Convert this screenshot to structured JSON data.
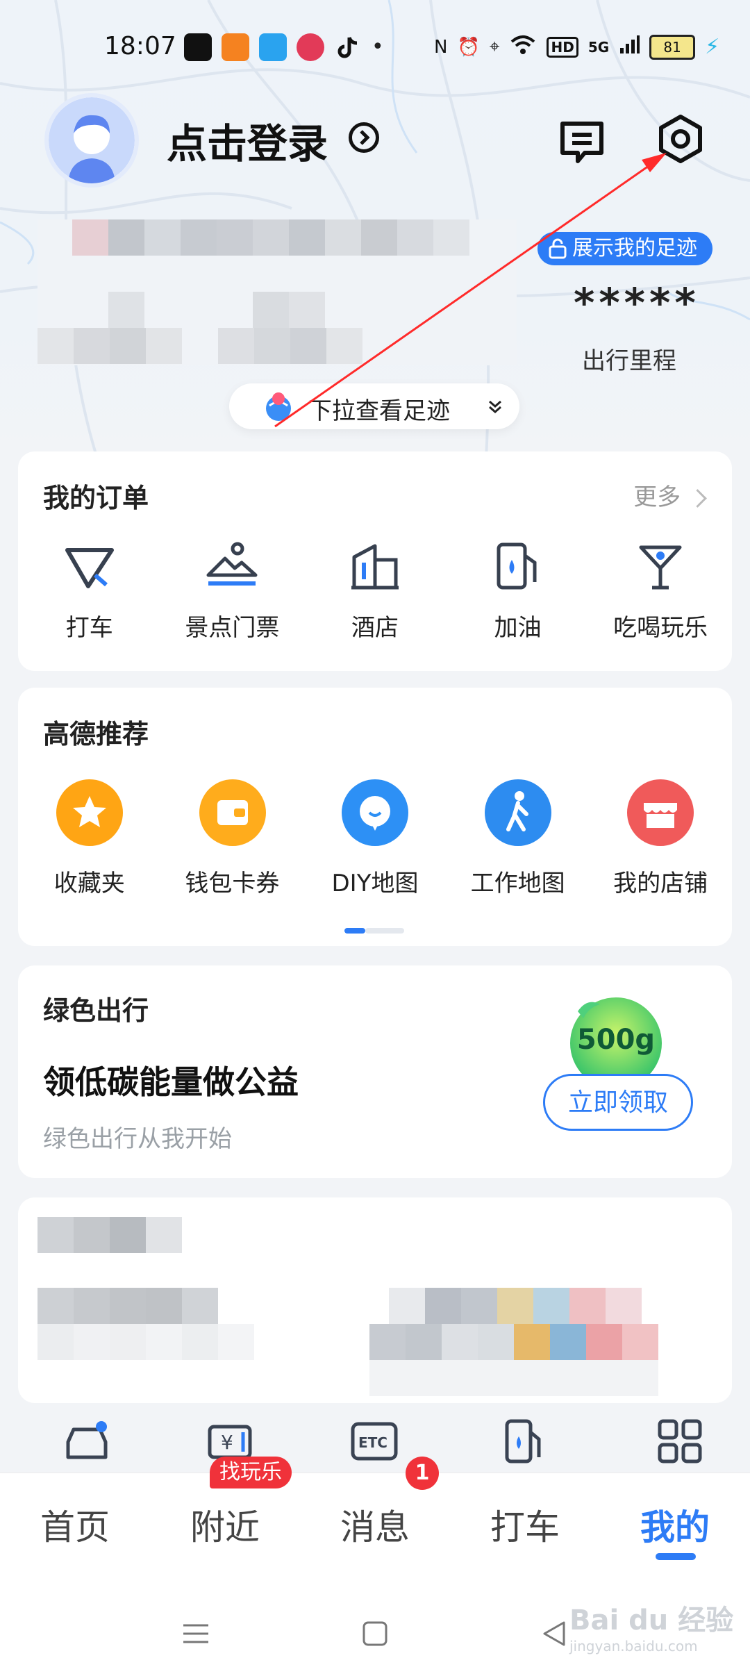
{
  "status_bar": {
    "time": "18:07",
    "network": "5G",
    "hd": "HD",
    "battery": "81"
  },
  "header": {
    "login_text": "点击登录",
    "footprint_badge": "展示我的足迹",
    "mileage_masked": "*****",
    "mileage_label": "出行里程",
    "pull_hint": "下拉查看足迹"
  },
  "orders": {
    "title": "我的订单",
    "more": "更多",
    "items": [
      {
        "label": "打车",
        "icon": "taxi-triangle-icon"
      },
      {
        "label": "景点门票",
        "icon": "scenic-ticket-icon"
      },
      {
        "label": "酒店",
        "icon": "hotel-building-icon"
      },
      {
        "label": "加油",
        "icon": "fuel-pump-icon"
      },
      {
        "label": "吃喝玩乐",
        "icon": "cocktail-icon"
      }
    ]
  },
  "recommend": {
    "title": "高德推荐",
    "items": [
      {
        "label": "收藏夹",
        "icon": "star-icon",
        "color": "#ff9d0a"
      },
      {
        "label": "钱包卡券",
        "icon": "wallet-icon",
        "color": "#ffa514"
      },
      {
        "label": "DIY地图",
        "icon": "diy-map-icon",
        "color": "#2d90f5"
      },
      {
        "label": "工作地图",
        "icon": "walking-person-icon",
        "color": "#2d8cf0"
      },
      {
        "label": "我的店铺",
        "icon": "shop-icon",
        "color": "#f05a5a"
      }
    ]
  },
  "green": {
    "title": "绿色出行",
    "headline": "领低碳能量做公益",
    "sub": "绿色出行从我开始",
    "energy": "500g",
    "button": "立即领取"
  },
  "tools": [
    {
      "icon": "car-service-icon"
    },
    {
      "icon": "yuan-card-icon"
    },
    {
      "icon": "etc-icon"
    },
    {
      "icon": "fuel-station-icon"
    },
    {
      "icon": "apps-grid-icon"
    }
  ],
  "nav": {
    "tabs": [
      "首页",
      "附近",
      "消息",
      "打车",
      "我的"
    ],
    "nearby_badge": "找玩乐",
    "message_count": "1",
    "active": "我的"
  },
  "watermark": {
    "main": "Bai du 经验",
    "sub": "jingyan.baidu.com"
  },
  "colors": {
    "accent": "#2d7cf6",
    "badge": "#f0323a",
    "green": "#3ec66b"
  }
}
